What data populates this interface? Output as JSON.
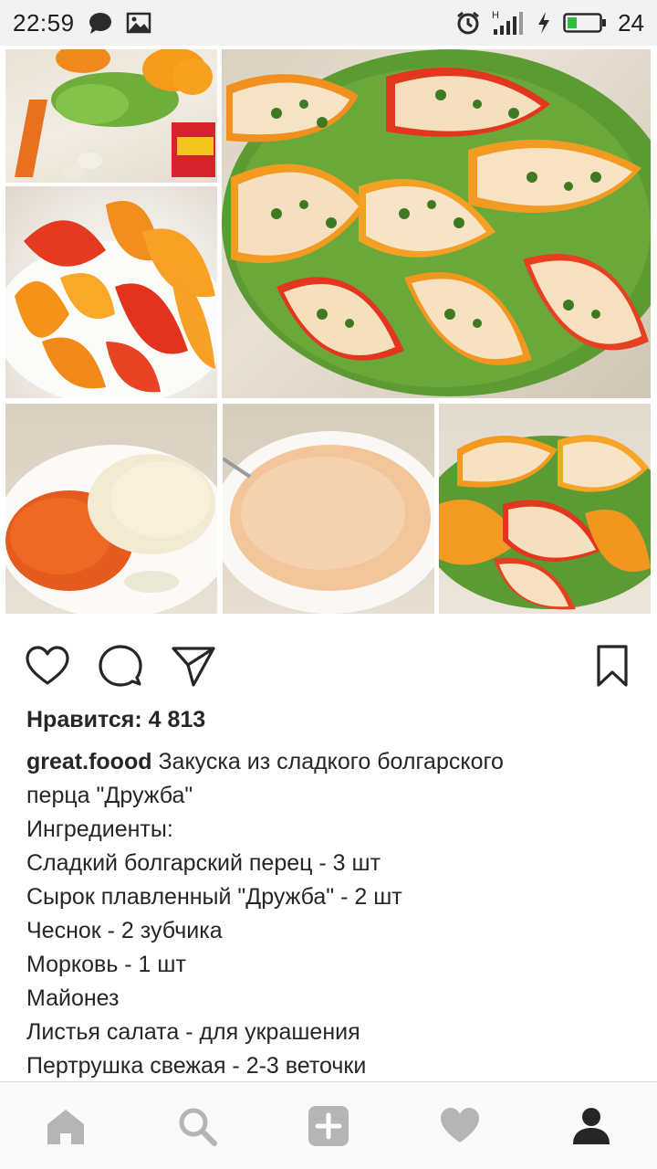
{
  "status_bar": {
    "time": "22:59",
    "battery_level": "24",
    "network_label": "H",
    "icons": [
      "chat-bubble-icon",
      "image-icon",
      "alarm-icon",
      "signal-icon",
      "charging-icon",
      "battery-icon"
    ]
  },
  "post": {
    "images": [
      "ingredients-vegetables-photo",
      "sliced-peppers-photo",
      "stuffed-peppers-platter-photo",
      "grated-carrot-cheese-photo",
      "mixed-filling-photo",
      "finished-stuffed-peppers-photo"
    ],
    "likes_text": "Нравится: 4 813",
    "username": "great.foood",
    "caption_first": "Закуска из сладкого болгарского",
    "caption_lines": [
      "перца \"Дружба\"",
      "Ингредиенты:",
      "Сладкий болгарский перец - 3 шт",
      "Сырок плавленный \"Дружба\" - 2 шт",
      "Чеснок - 2 зубчика",
      "Морковь - 1 шт",
      "Майонез",
      "Листья салата - для украшения",
      "Пертрушка свежая - 2-3 веточки"
    ]
  },
  "actions": [
    "heart-icon",
    "comment-icon",
    "share-icon",
    "bookmark-icon"
  ],
  "bottom_nav": [
    "home-icon",
    "search-icon",
    "add-icon",
    "heart-icon",
    "profile-icon"
  ]
}
